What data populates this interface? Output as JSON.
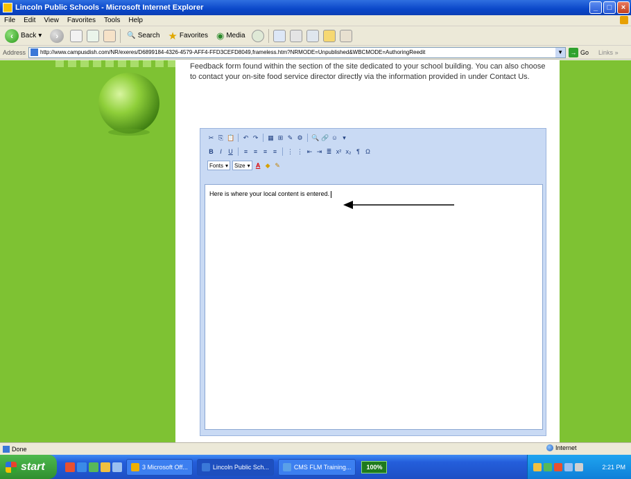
{
  "window": {
    "title": "Lincoln Public Schools - Microsoft Internet Explorer",
    "controls": [
      "_",
      "□",
      "×"
    ]
  },
  "menu": [
    "File",
    "Edit",
    "View",
    "Favorites",
    "Tools",
    "Help"
  ],
  "toolbar": {
    "back": "Back",
    "search": "Search",
    "favorites": "Favorites",
    "media": "Media"
  },
  "address": {
    "label": "Address",
    "url": "http://www.campusdish.com/NR/exeres/D6899184-4326-4579-AFF4-FFD3CEFD8049,frameless.htm?NRMODE=Unpublished&WBCMODE=AuthoringReedit",
    "go": "Go",
    "links": "Links"
  },
  "page": {
    "intro": "Feedback form found within the section of the site dedicated to your school building. You can also choose to contact your on-site food service director directly via the information provided in under Contact Us.",
    "editor": {
      "row1": [
        "✂",
        "⎘",
        "📋",
        "↶",
        "↷",
        "▦",
        "⊞",
        "✎",
        "⚙",
        "🔍",
        "🔗",
        "☺",
        "▾"
      ],
      "row2": [
        "B",
        "I",
        "U",
        "≡",
        "≡",
        "≡",
        "≡",
        "⋮",
        "⋮",
        "⇤",
        "⇥",
        "≣",
        "x²",
        "x₂",
        "¶",
        "Ω"
      ],
      "fonts_label": "Fonts",
      "size_label": "Size",
      "content": "Here is where your local content is entered."
    }
  },
  "status": {
    "left": "Done",
    "zone": "Internet"
  },
  "taskbar": {
    "start": "start",
    "tasks": [
      "3 Microsoft Off...",
      "Lincoln Public Sch...",
      "CMS FLM Training..."
    ],
    "zoom": "100%",
    "clock": "2:21 PM"
  }
}
